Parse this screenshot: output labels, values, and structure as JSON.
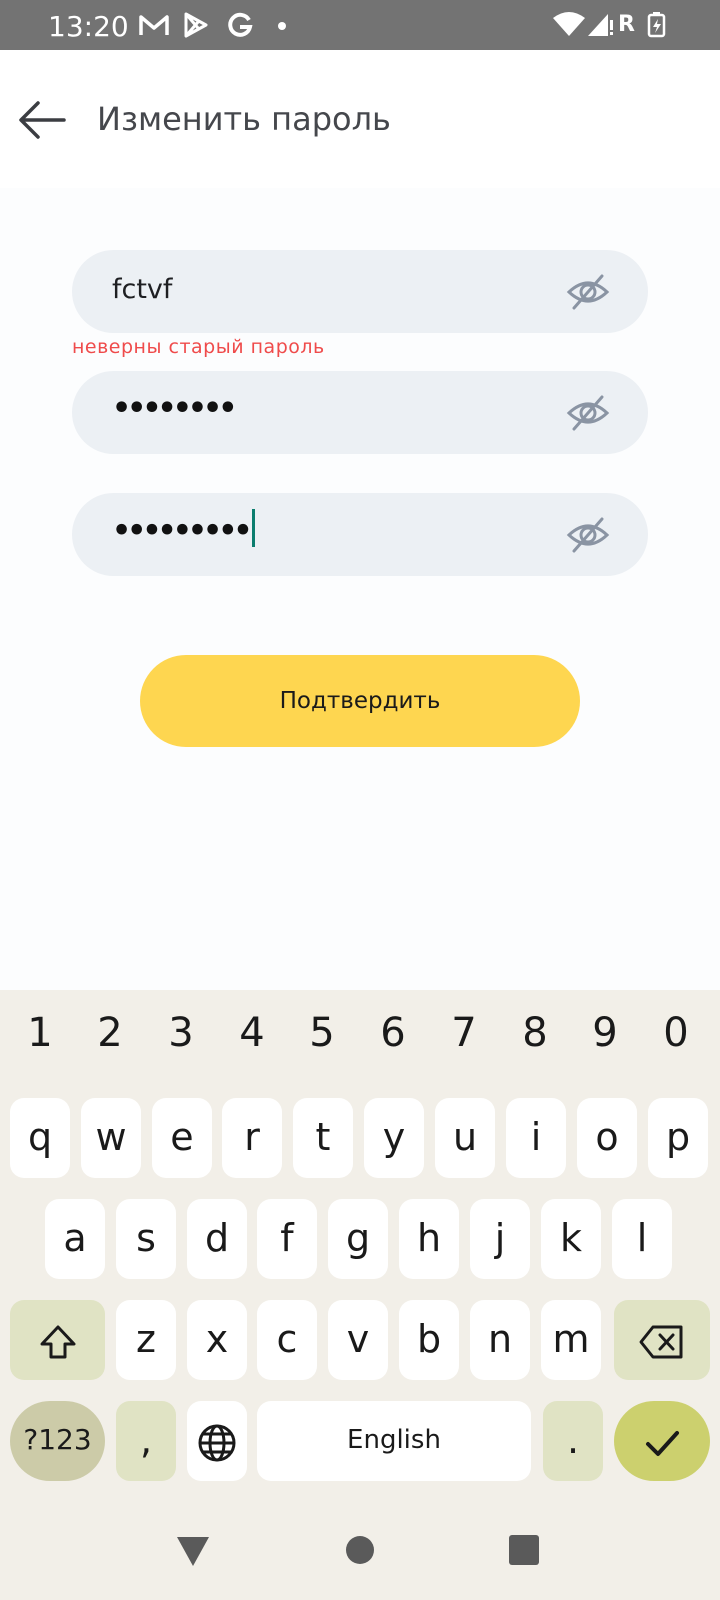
{
  "status_bar": {
    "time": "13:20",
    "left_icons": [
      "gmail-icon",
      "play-store-icon",
      "google-icon",
      "dot-icon"
    ],
    "right_icons": [
      "wifi-icon",
      "signal-icon",
      "roaming-icon",
      "battery-charging-icon"
    ],
    "roaming_label": "R"
  },
  "header": {
    "title": "Изменить пароль"
  },
  "form": {
    "old_password_value": "fctvf",
    "old_password_error": "неверны старый пароль",
    "new_password_masked": "••••••••",
    "confirm_password_masked": "•••••••••",
    "confirm_button_label": "Подтвердить"
  },
  "keyboard": {
    "numbers": [
      "1",
      "2",
      "3",
      "4",
      "5",
      "6",
      "7",
      "8",
      "9",
      "0"
    ],
    "row1": [
      "q",
      "w",
      "e",
      "r",
      "t",
      "y",
      "u",
      "i",
      "o",
      "p"
    ],
    "row2": [
      "a",
      "s",
      "d",
      "f",
      "g",
      "h",
      "j",
      "k",
      "l"
    ],
    "row3": [
      "z",
      "x",
      "c",
      "v",
      "b",
      "n",
      "m"
    ],
    "symbols_label": "?123",
    "comma_label": ",",
    "space_label": "English",
    "period_label": "."
  },
  "colors": {
    "accent": "#fed650",
    "error": "#ef4b4b",
    "field_bg": "#ecf0f4",
    "caret": "#0b7d6e"
  }
}
